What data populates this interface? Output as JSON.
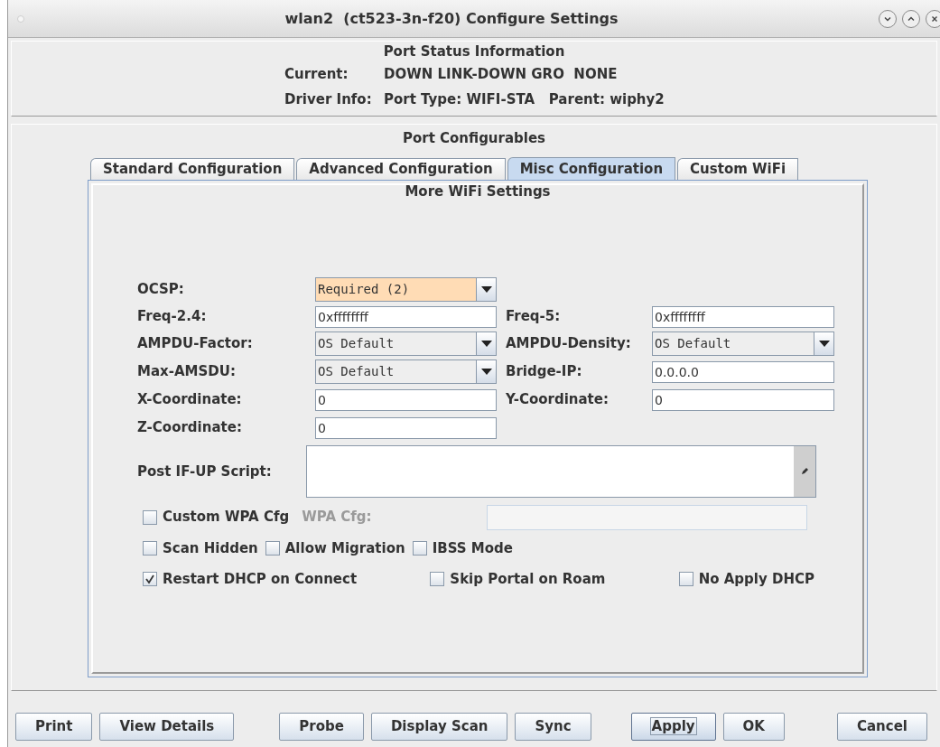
{
  "window": {
    "title": "wlan2  (ct523-3n-f20) Configure Settings"
  },
  "status": {
    "heading": "Port Status Information",
    "rows": [
      {
        "label": "Current:",
        "value": "DOWN LINK-DOWN GRO  NONE"
      },
      {
        "label": "Driver Info:",
        "value": "Port Type: WIFI-STA   Parent: wiphy2"
      }
    ]
  },
  "configurables": {
    "heading": "Port Configurables",
    "tabs": [
      {
        "label": "Standard Configuration",
        "selected": false
      },
      {
        "label": "Advanced Configuration",
        "selected": false
      },
      {
        "label": "Misc Configuration",
        "selected": true
      },
      {
        "label": "Custom WiFi",
        "selected": false
      }
    ],
    "panel": {
      "heading": "More WiFi Settings",
      "rows": [
        [
          {
            "label": "OCSP:",
            "kind": "select",
            "value": "Required (2)",
            "highlighted": true
          }
        ],
        [
          {
            "label": "Freq-2.4:",
            "kind": "text",
            "value": "0xffffffff"
          },
          {
            "label": "Freq-5:",
            "kind": "text",
            "value": "0xffffffff"
          }
        ],
        [
          {
            "label": "AMPDU-Factor:",
            "kind": "select",
            "value": "OS Default",
            "highlighted": false
          },
          {
            "label": "AMPDU-Density:",
            "kind": "select",
            "value": "OS Default",
            "highlighted": false
          }
        ],
        [
          {
            "label": "Max-AMSDU:",
            "kind": "select",
            "value": "OS Default",
            "highlighted": false
          },
          {
            "label": "Bridge-IP:",
            "kind": "text",
            "value": "0.0.0.0"
          }
        ],
        [
          {
            "label": "X-Coordinate:",
            "kind": "text",
            "value": "0"
          },
          {
            "label": "Y-Coordinate:",
            "kind": "text",
            "value": "0"
          }
        ],
        [
          {
            "label": "Z-Coordinate:",
            "kind": "text",
            "value": "0"
          }
        ]
      ],
      "script": {
        "label": "Post IF-UP Script:"
      },
      "wpa": {
        "checkbox": {
          "label": "Custom WPA Cfg",
          "checked": false
        },
        "label": "WPA Cfg:",
        "disabled": true
      },
      "options": [
        {
          "label": "Scan Hidden",
          "checked": false
        },
        {
          "label": "Allow Migration",
          "checked": false
        },
        {
          "label": "IBSS Mode",
          "checked": false
        }
      ],
      "options_2": [
        {
          "label": "Restart DHCP on Connect",
          "checked": true
        },
        {
          "label": "Skip Portal on Roam",
          "checked": false
        },
        {
          "label": "No Apply DHCP",
          "checked": false
        }
      ]
    }
  },
  "buttons": [
    [
      {
        "label": "Print",
        "focused": false
      },
      {
        "label": "View Details",
        "focused": false
      }
    ],
    [
      {
        "label": "Probe",
        "focused": false
      },
      {
        "label": "Display Scan",
        "focused": false
      },
      {
        "label": "Sync",
        "focused": false
      }
    ],
    [
      {
        "label": "Apply",
        "focused": true
      },
      {
        "label": "OK",
        "focused": false
      }
    ],
    [
      {
        "label": "Cancel",
        "focused": false
      }
    ]
  ]
}
